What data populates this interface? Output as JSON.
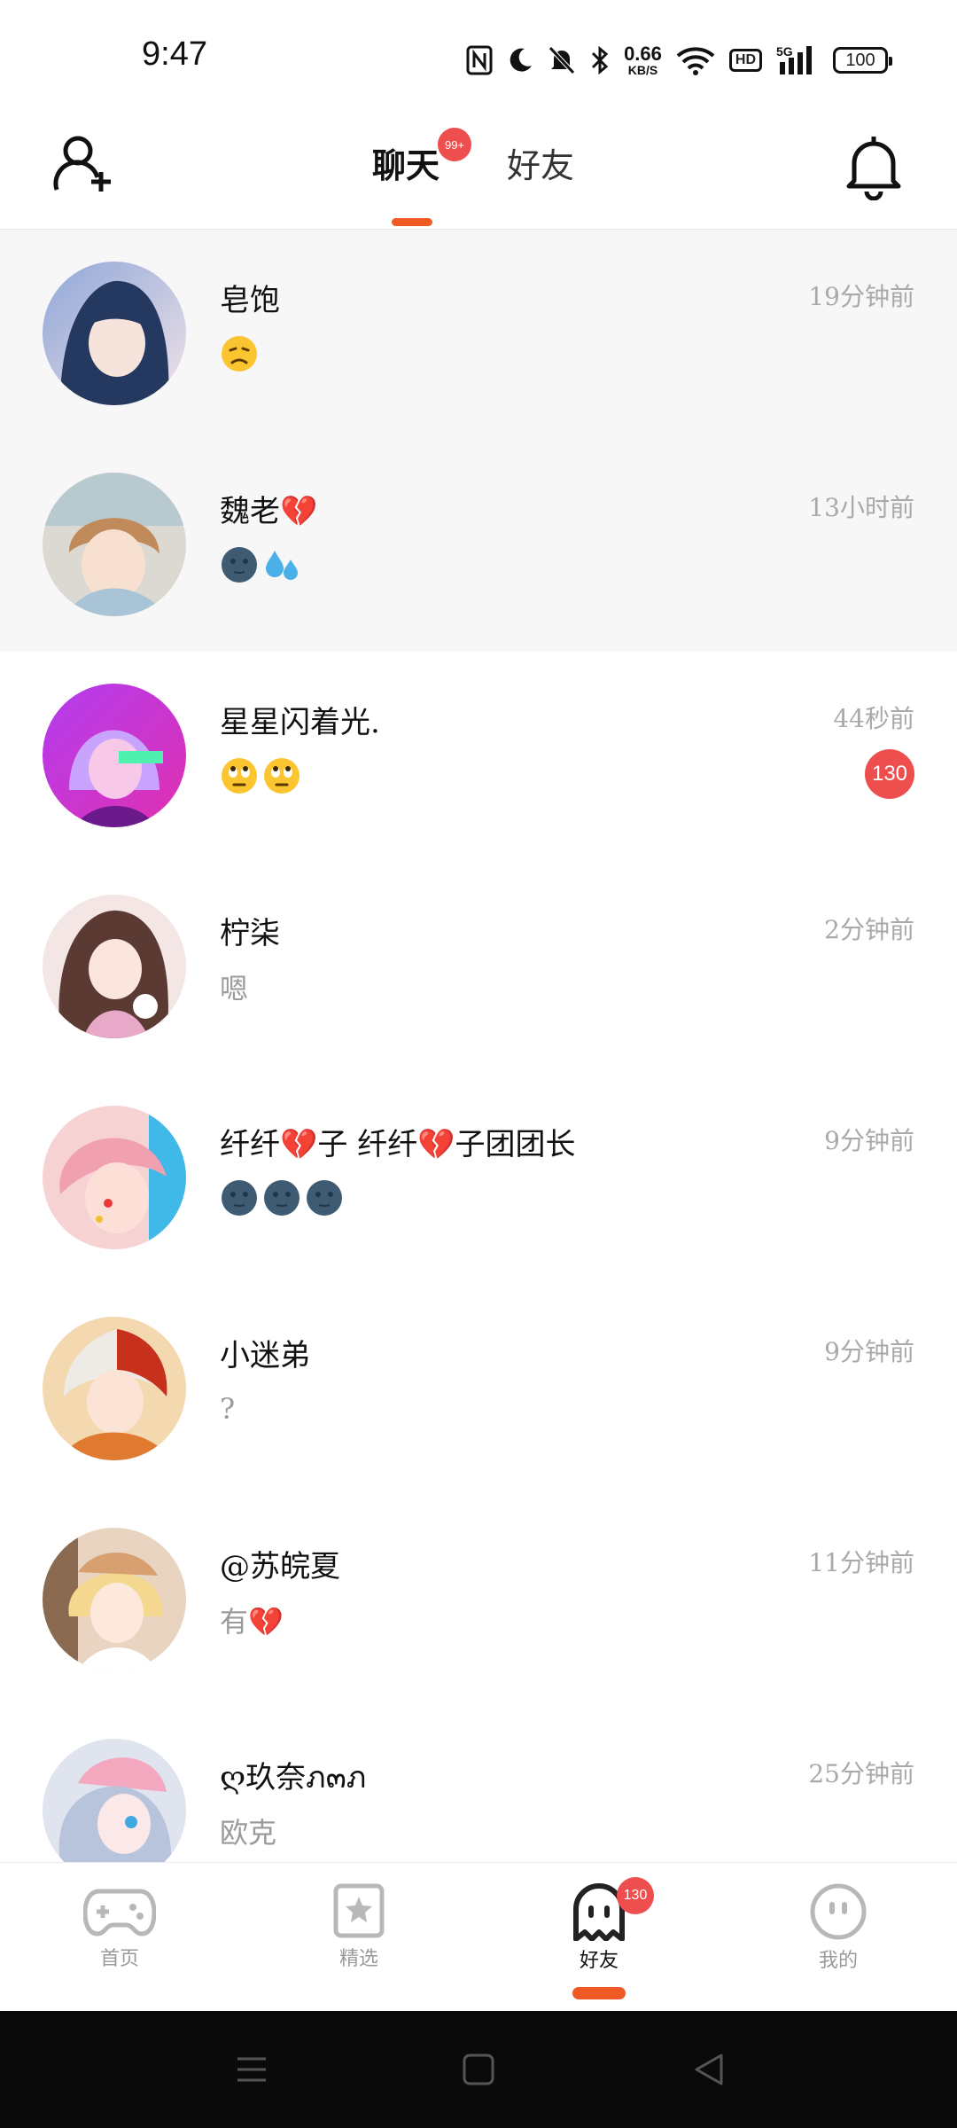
{
  "status_bar": {
    "time": "9:47",
    "net_speed_value": "0.66",
    "net_speed_unit": "KB/S",
    "hd_label": "HD",
    "network_label": "5G",
    "battery": "100"
  },
  "header": {
    "tabs": [
      {
        "label": "聊天",
        "active": true
      },
      {
        "label": "好友",
        "active": false
      }
    ],
    "chat_badge": "99+"
  },
  "chats": [
    {
      "name": "皂饱",
      "time": "19分钟前",
      "preview_text": "",
      "emojis": [
        "disappointed"
      ],
      "pinned": true,
      "unread": ""
    },
    {
      "name": "魏老💔",
      "time": "13小时前",
      "preview_text": "",
      "emojis": [
        "new-moon-face",
        "sweat-droplets"
      ],
      "pinned": true,
      "unread": ""
    },
    {
      "name": "星星闪着光.",
      "time": "44秒前",
      "preview_text": "",
      "emojis": [
        "eye-roll",
        "eye-roll"
      ],
      "pinned": false,
      "unread": "130"
    },
    {
      "name": "柠柒",
      "time": "2分钟前",
      "preview_text": "嗯",
      "emojis": [],
      "pinned": false,
      "unread": ""
    },
    {
      "name": "纤纤💔子 纤纤💔子团团长",
      "time": "9分钟前",
      "preview_text": "",
      "emojis": [
        "new-moon-face",
        "new-moon-face",
        "new-moon-face"
      ],
      "pinned": false,
      "unread": ""
    },
    {
      "name": "小迷弟",
      "time": "9分钟前",
      "preview_text": "?",
      "emojis": [],
      "pinned": false,
      "unread": ""
    },
    {
      "name": "@苏皖夏",
      "time": "11分钟前",
      "preview_text": "有💔",
      "emojis": [],
      "pinned": false,
      "unread": ""
    },
    {
      "name": "ღ玖奈ภ๓ภ",
      "time": "25分钟前",
      "preview_text": "欧克",
      "emojis": [],
      "pinned": false,
      "unread": ""
    }
  ],
  "bottom_tabs": [
    {
      "label": "首页",
      "icon": "gamepad-icon"
    },
    {
      "label": "精选",
      "icon": "star-bookmark-icon"
    },
    {
      "label": "好友",
      "icon": "ghost-icon",
      "badge": "130",
      "active": true
    },
    {
      "label": "我的",
      "icon": "face-icon"
    }
  ],
  "colors": {
    "accent": "#f05a24",
    "badge": "#ee4e4e",
    "muted_text": "#a9a9a9"
  }
}
